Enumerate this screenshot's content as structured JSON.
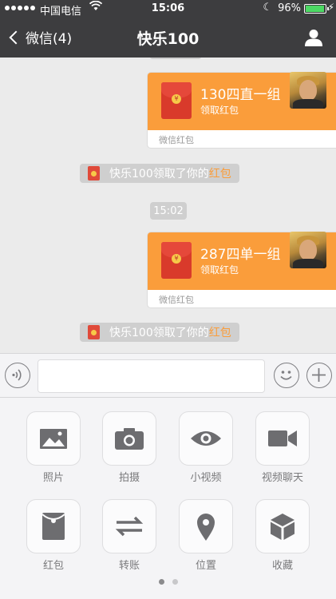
{
  "status_bar": {
    "carrier": "中国电信",
    "time": "15:06",
    "battery": "96%",
    "battery_level": 0.96
  },
  "nav": {
    "back_label": "微信(4)",
    "title": "快乐100"
  },
  "messages": [
    {
      "title": "130四直一组",
      "subtitle": "领取红包",
      "footer": "微信红包"
    },
    {
      "title": "287四单一组",
      "subtitle": "领取红包",
      "footer": "微信红包"
    }
  ],
  "system_notices": [
    {
      "text": "快乐100领取了你的",
      "link": "红包"
    },
    {
      "text": "快乐100领取了你的",
      "link": "红包"
    }
  ],
  "timestamp": "15:02",
  "input": {
    "value": "",
    "placeholder": ""
  },
  "panel": {
    "items": [
      {
        "label": "照片",
        "icon": "photo-icon"
      },
      {
        "label": "拍摄",
        "icon": "camera-icon"
      },
      {
        "label": "小视频",
        "icon": "eye-icon"
      },
      {
        "label": "视频聊天",
        "icon": "video-camera-icon"
      },
      {
        "label": "红包",
        "icon": "red-packet-icon"
      },
      {
        "label": "转账",
        "icon": "transfer-icon"
      },
      {
        "label": "位置",
        "icon": "location-pin-icon"
      },
      {
        "label": "收藏",
        "icon": "favorites-box-icon"
      }
    ],
    "page": 1,
    "page_count": 2
  },
  "colors": {
    "nav_bg": "#3d3d3f",
    "red_packet_orange": "#fa9d3b",
    "chat_bg": "#ebebeb",
    "battery_green": "#4cd964"
  }
}
